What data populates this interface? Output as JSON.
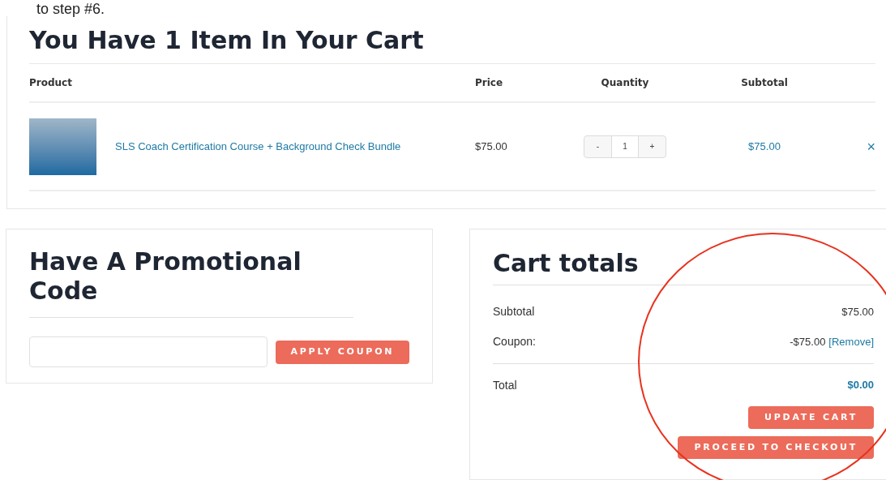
{
  "caption": "to step #6.",
  "cart": {
    "title": "You Have 1 Item In Your Cart",
    "columns": [
      "Product",
      "Price",
      "Quantity",
      "Subtotal"
    ],
    "items": [
      {
        "name": "SLS Coach Certification Course + Background Check Bundle",
        "price": "$75.00",
        "decrement": "-",
        "quantity": "1",
        "increment": "+",
        "subtotal": "$75.00",
        "remove": "×"
      }
    ]
  },
  "promo": {
    "title": "Have A Promotional Code",
    "button": "APPLY COUPON"
  },
  "totals": {
    "title": "Cart totals",
    "rows": [
      {
        "label": "Subtotal",
        "value": "$75.00"
      },
      {
        "label": "Coupon:",
        "value": "-$75.00",
        "link": "[Remove]"
      }
    ],
    "total": {
      "label": "Total",
      "value": "$0.00"
    },
    "buttons": [
      "UPDATE CART",
      "PROCEED TO CHECKOUT"
    ]
  }
}
